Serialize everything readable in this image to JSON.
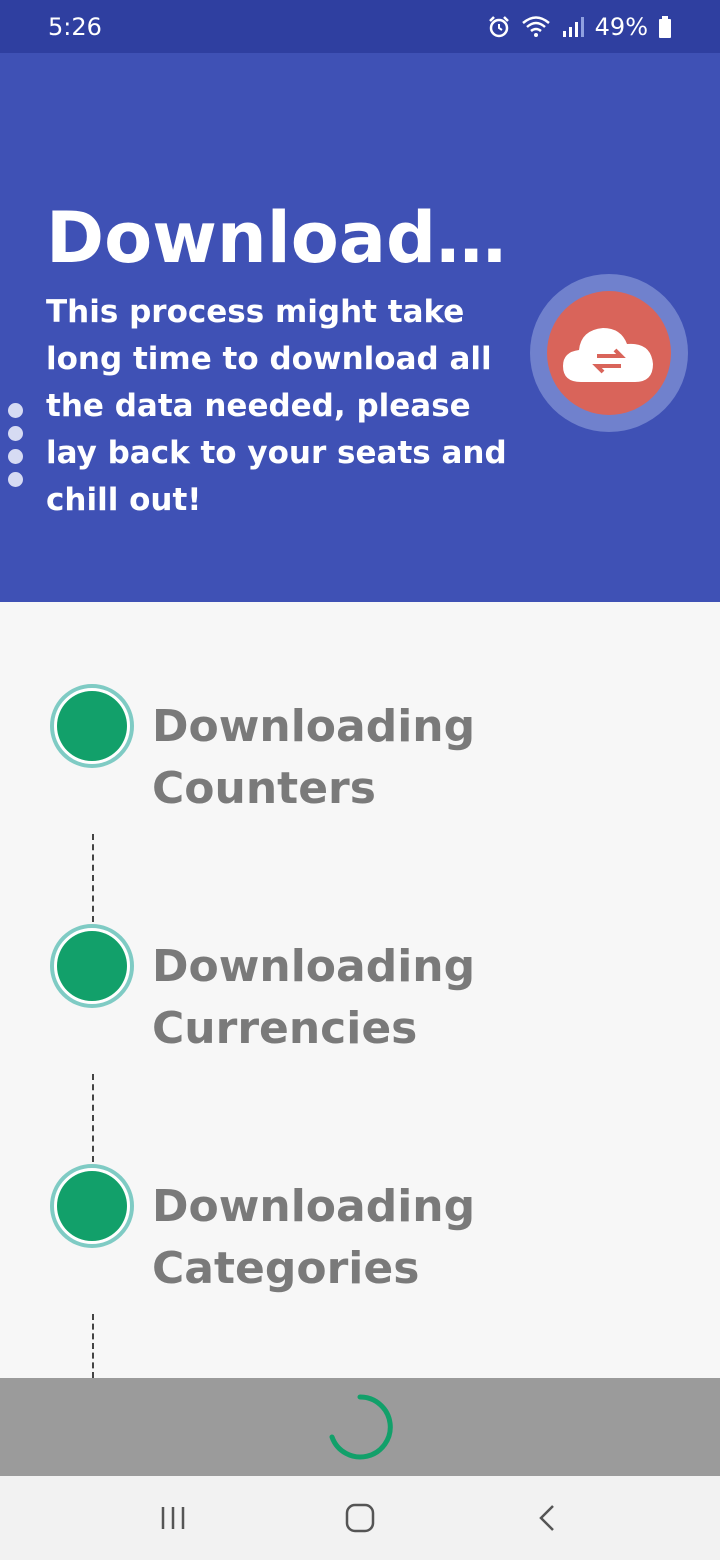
{
  "status_bar": {
    "time": "5:26",
    "battery_percent": "49%",
    "icons": [
      "alarm-icon",
      "wifi-icon",
      "signal-icon",
      "battery-icon"
    ]
  },
  "header": {
    "title": "Downloading...",
    "subtitle": "This process might take long time to download all the data needed, please lay back to your seats and chill out!",
    "icon": "cloud-sync-icon",
    "colors": {
      "background": "#3f51b5",
      "icon_circle": "#d9645a"
    }
  },
  "steps": [
    {
      "label": "Downloading Counters",
      "status": "done"
    },
    {
      "label": "Downloading Currencies",
      "status": "done"
    },
    {
      "label": "Downloading Categories",
      "status": "done"
    }
  ],
  "loading": {
    "icon": "progress-spinner",
    "color": "#12a06a"
  },
  "nav_bar": {
    "buttons": [
      "recent-apps",
      "home",
      "back"
    ]
  }
}
